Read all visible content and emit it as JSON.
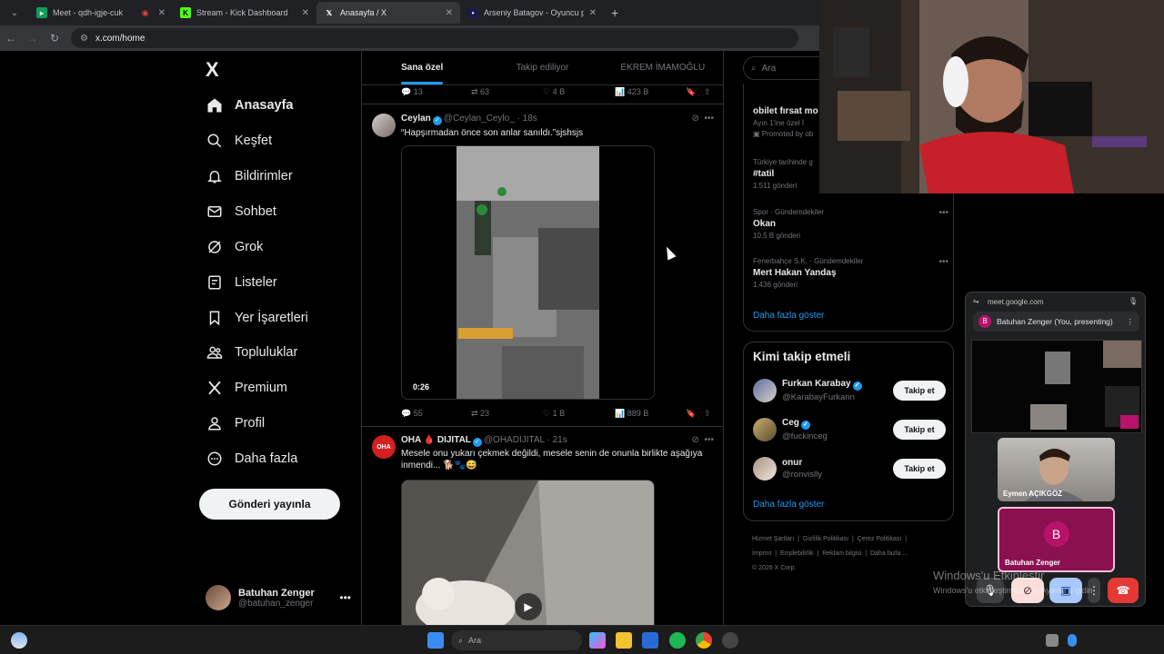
{
  "browser": {
    "tabs": [
      {
        "label": "Meet - qdh-igje-cuk",
        "active": false
      },
      {
        "label": "Stream - Kick Dashboard",
        "active": false
      },
      {
        "label": "Anasayfa / X",
        "active": true
      },
      {
        "label": "Arseniy Batagov - Oyuncu profi",
        "active": false
      }
    ],
    "url": "x.com/home"
  },
  "sidebar": {
    "logo": "X",
    "items": [
      {
        "label": "Anasayfa",
        "icon": "home-icon"
      },
      {
        "label": "Keşfet",
        "icon": "search-icon"
      },
      {
        "label": "Bildirimler",
        "icon": "bell-icon"
      },
      {
        "label": "Sohbet",
        "icon": "mail-icon"
      },
      {
        "label": "Grok",
        "icon": "grok-icon"
      },
      {
        "label": "Listeler",
        "icon": "list-icon"
      },
      {
        "label": "Yer İşaretleri",
        "icon": "bookmark-icon"
      },
      {
        "label": "Topluluklar",
        "icon": "people-icon"
      },
      {
        "label": "Premium",
        "icon": "x-icon"
      },
      {
        "label": "Profil",
        "icon": "person-icon"
      },
      {
        "label": "Daha fazla",
        "icon": "more-circle-icon"
      }
    ],
    "post_button": "Gönderi yayınla",
    "account": {
      "name": "Batuhan Zenger",
      "handle": "@batuhan_zenger"
    }
  },
  "feed": {
    "tabs": [
      "Sana özel",
      "Takip ediliyor",
      "EKREM İMAMOĞLU"
    ],
    "prev_actions": {
      "replies": "13",
      "reposts": "63",
      "likes": "4 B",
      "views": "423 B"
    },
    "tweet1": {
      "name": "Ceylan",
      "handle": "@Ceylan_Ceylo_",
      "time": "· 18s",
      "text": "“Hapşırmadan önce son anlar sanıldı.”sjshsjs",
      "duration": "0:26",
      "actions": {
        "replies": "55",
        "reposts": "23",
        "likes": "1 B",
        "views": "889 B"
      }
    },
    "tweet2": {
      "name": "OHA 🩸 DIJITAL",
      "handle": "@OHADIJITAL",
      "time": "· 21s",
      "avatar_text": "OHA",
      "text": "Mesele onu yukarı çekmek değildi, mesele senin de onunla birlikte aşağıya inmendi... 🐕🐾😅"
    }
  },
  "right": {
    "search_placeholder": "Ara",
    "trends": [
      {
        "category": "",
        "name": "obilet fırsat mo",
        "count": "Ayın 1'ine özel İ",
        "promo": "Promoted by ob"
      },
      {
        "category": "Türkiye tarihinde g",
        "name": "#tatil",
        "count": "1.511 gönderi"
      },
      {
        "category": "Spor · Gündemdekiler",
        "name": "Okan",
        "count": "10,5 B gönderi"
      },
      {
        "category": "Fenerbahçe S.K. · Gündemdekiler",
        "name": "Mert Hakan Yandaş",
        "count": "1.436 gönderi"
      }
    ],
    "show_more": "Daha fazla göster",
    "who_title": "Kimi takip etmeli",
    "who": [
      {
        "name": "Furkan Karabay",
        "handle": "@KarabayFurkann",
        "verified": true
      },
      {
        "name": "Ceg",
        "handle": "@fuckinceg",
        "verified": true
      },
      {
        "name": "onur",
        "handle": "@ronvislly",
        "verified": false
      }
    ],
    "follow_label": "Takip et",
    "footer": [
      "Hizmet Şartları",
      "Gizlilik Politikası",
      "Çerez Politikası",
      "İmprint",
      "Erişilebilirlik",
      "Reklam bilgisi",
      "Daha fazla ...",
      "© 2026 X Corp."
    ]
  },
  "meet": {
    "url": "meet.google.com",
    "presenting": "Batuhan Zenger (You, presenting)",
    "avatar_letter": "B",
    "tiles": [
      "Eymen AÇIKGÖZ",
      "Batuhan Zenger"
    ]
  },
  "watermark": {
    "line1": "Windows'u Etkinleştir",
    "line2": "Windows'u etkinleştirmek için Ayarlar'a gidin"
  },
  "taskbar": {
    "search": "Ara"
  },
  "colors": {
    "accent": "#1d9bf0",
    "meet_avatar": "#b8136b",
    "end_call": "#e53935"
  }
}
